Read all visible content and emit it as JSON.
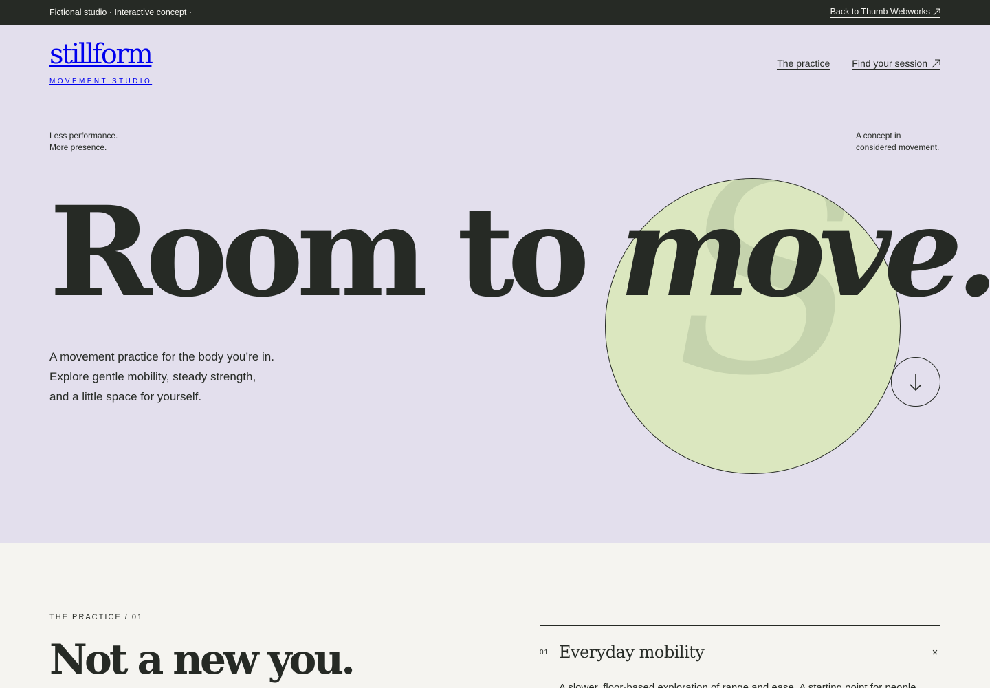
{
  "topbar": {
    "left_text": "Fictional studio · Interactive concept ·",
    "back_link": "Back to Thumb Webworks"
  },
  "header": {
    "logo_wordmark": "stillform",
    "logo_sub": "MOVEMENT STUDIO",
    "nav": {
      "practice": "The practice",
      "session": "Find your session"
    }
  },
  "hero": {
    "tagline_left": [
      "Less performance.",
      "More presence."
    ],
    "tagline_right": [
      "A concept in",
      "considered movement."
    ],
    "headline_regular": "Room to ",
    "headline_italic": "move.",
    "circle_glyph": "S",
    "intro": [
      "A movement practice for the body you’re in.",
      "Explore gentle mobility, steady strength,",
      "and a little space for yourself."
    ]
  },
  "practice": {
    "eyebrow": "THE PRACTICE / 01",
    "title": "Not a new you.",
    "accordion": {
      "number": "01",
      "title": "Everyday mobility",
      "close_glyph": "×",
      "body": "A slower, floor-based exploration of range and ease. A starting point for people"
    }
  },
  "colors": {
    "ink": "#262a25",
    "lavender": "#e3dfed",
    "lime": "#dbe7bf",
    "paper": "#f5f4f0"
  }
}
